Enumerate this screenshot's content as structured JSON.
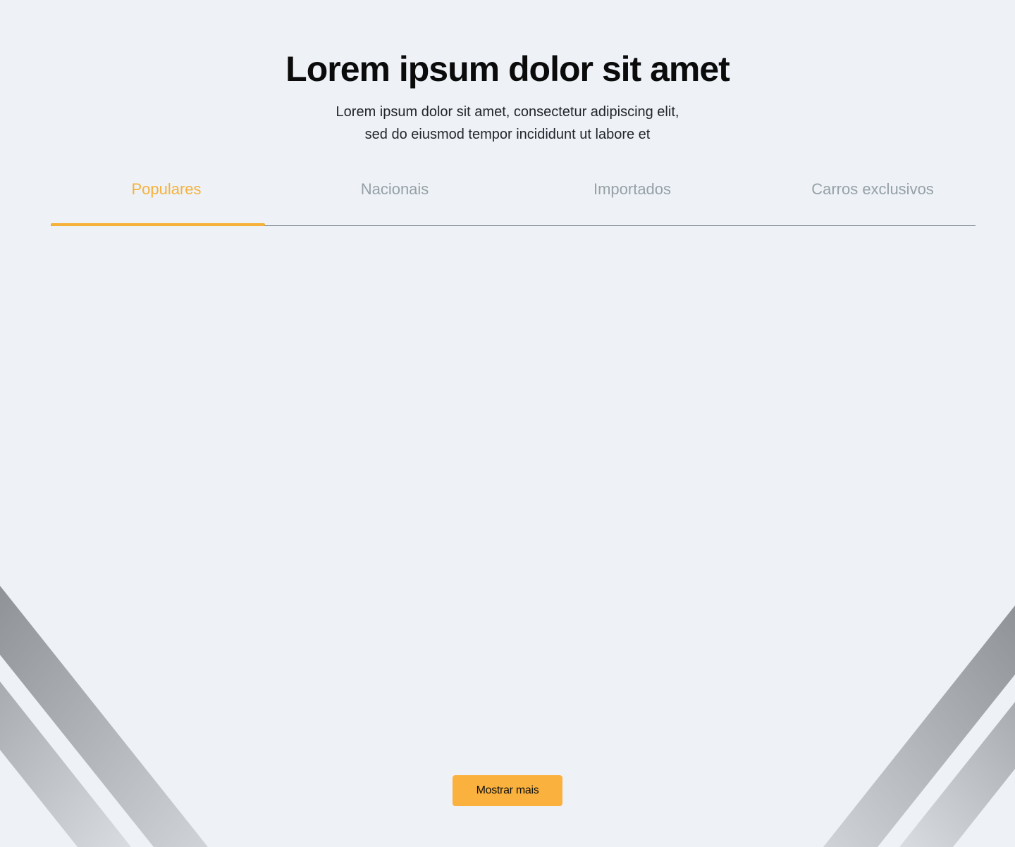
{
  "header": {
    "title": "Lorem ipsum dolor sit amet",
    "subtitle_line1": "Lorem ipsum dolor sit amet, consectetur adipiscing elit,",
    "subtitle_line2": "sed do eiusmod tempor incididunt ut labore et"
  },
  "tabs": [
    {
      "label": "Populares",
      "active": true
    },
    {
      "label": "Nacionais",
      "active": false
    },
    {
      "label": "Importados",
      "active": false
    },
    {
      "label": "Carros exclusivos",
      "active": false
    }
  ],
  "footer": {
    "show_more_label": "Mostrar mais"
  },
  "colors": {
    "background": "#EEF2F7",
    "accent": "#F5B13C",
    "tab_inactive": "#95A1A7",
    "divider": "#7E8A91",
    "title": "#0B0B0B"
  }
}
